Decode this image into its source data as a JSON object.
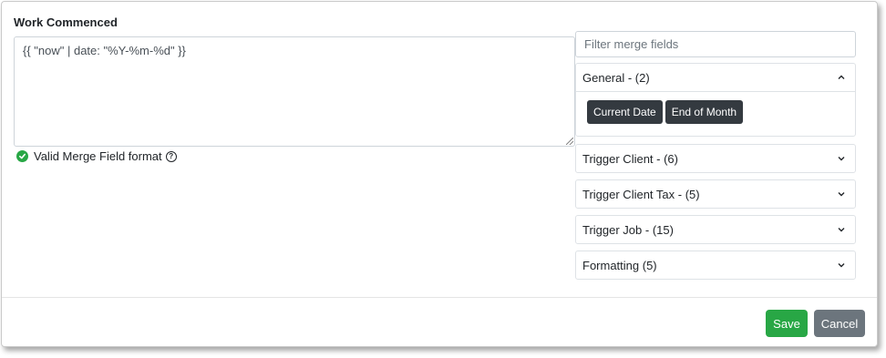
{
  "field": {
    "label": "Work Commenced",
    "value": "{{ \"now\" | date: \"%Y-%m-%d\" }}"
  },
  "validation": {
    "text": "Valid Merge Field format",
    "status_color": "#28a745"
  },
  "merge_fields": {
    "filter_placeholder": "Filter merge fields",
    "groups": [
      {
        "title": "General - (2)",
        "expanded": true,
        "items": [
          "Current Date",
          "End of Month"
        ]
      },
      {
        "title": "Trigger Client - (6)",
        "expanded": false
      },
      {
        "title": "Trigger Client Tax - (5)",
        "expanded": false
      },
      {
        "title": "Trigger Job - (15)",
        "expanded": false
      },
      {
        "title": "Formatting (5)",
        "expanded": false
      }
    ]
  },
  "footer": {
    "save_label": "Save",
    "cancel_label": "Cancel",
    "save_color": "#28a745",
    "cancel_color": "#6c757d"
  }
}
